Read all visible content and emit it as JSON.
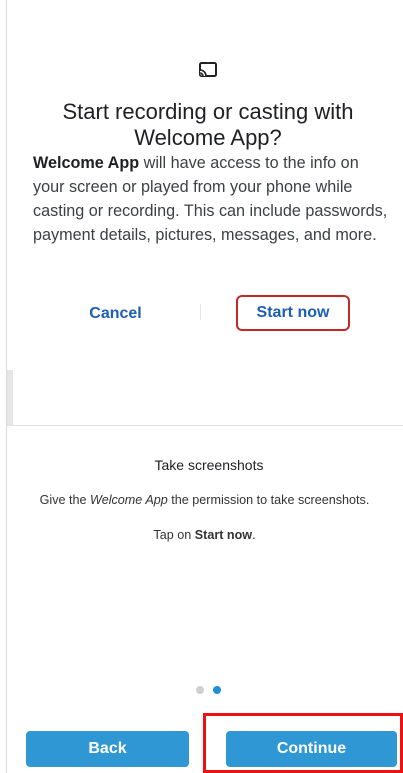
{
  "dialog": {
    "icon": "cast-icon",
    "title": "Start recording or casting with Welcome App?",
    "app_name": "Welcome App",
    "body_rest": " will have access to the info on your screen or played from your phone while casting or recording. This can include passwords, payment details, pictures, messages, and more.",
    "cancel_label": "Cancel",
    "start_label": "Start now"
  },
  "page": {
    "heading": "Take screenshots",
    "info_prefix": "Give the ",
    "info_app": "Welcome App",
    "info_suffix": " the permission to take screenshots.",
    "tap_prefix": "Tap on ",
    "tap_target": "Start now",
    "tap_suffix": "."
  },
  "pager": {
    "total": 2,
    "active": 2
  },
  "footer": {
    "back_label": "Back",
    "continue_label": "Continue"
  },
  "colors": {
    "accent": "#2f97d3",
    "link": "#1a5fb4",
    "highlight": "#ee1111"
  }
}
